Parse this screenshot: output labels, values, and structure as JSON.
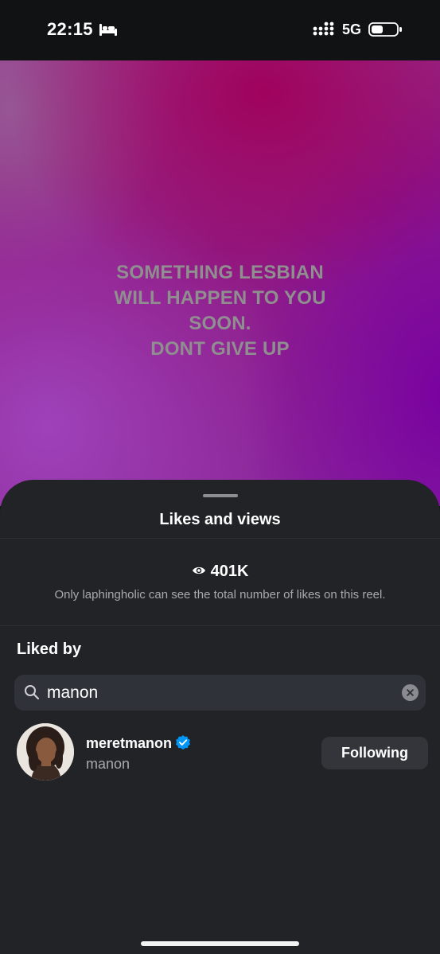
{
  "status_bar": {
    "time": "22:15",
    "network": "5G",
    "icons": [
      "bed-icon",
      "signal-icon",
      "battery-icon"
    ]
  },
  "reel": {
    "caption_lines": [
      "SOMETHING LESBIAN",
      "WILL HAPPEN TO YOU",
      "SOON.",
      "DONT GIVE UP"
    ],
    "colors": {
      "magenta": "#8f1a84",
      "purple": "#7a10a0",
      "caption_text": "#8f8f8f"
    }
  },
  "sheet": {
    "title": "Likes and views",
    "views_count": "401K",
    "views_icon": "eye-icon",
    "views_note": "Only laphingholic can see the total number of likes on this reel.",
    "liked_by_title": "Liked by",
    "search": {
      "value": "manon",
      "icon": "search-icon",
      "clear_icon": "clear-icon"
    },
    "users": [
      {
        "username": "meretmanon",
        "verified": true,
        "full_name": "manon",
        "action_label": "Following"
      }
    ],
    "colors": {
      "background": "#222327",
      "verified_badge": "#0095f6",
      "button_bg": "#33353b"
    }
  }
}
